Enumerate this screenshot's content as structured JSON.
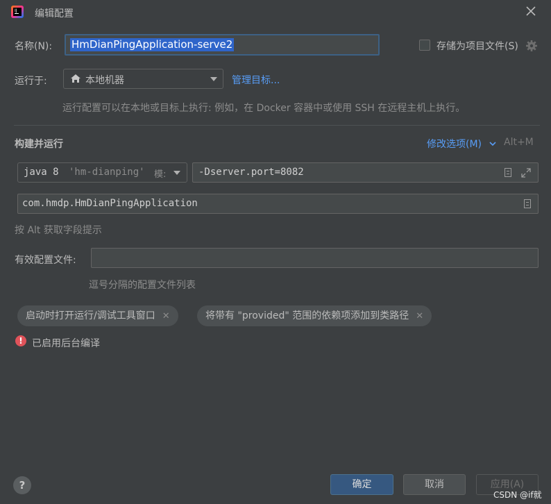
{
  "window": {
    "title": "编辑配置"
  },
  "name_row": {
    "label": "名称(N):",
    "value": "HmDianPingApplication-serve2",
    "store_checkbox_label": "存储为项目文件(S)"
  },
  "run_on": {
    "label": "运行于:",
    "selected": "本地机器",
    "manage_link": "管理目标...",
    "hint": "运行配置可以在本地或目标上执行: 例如，在 Docker 容器中或使用 SSH 在远程主机上执行。"
  },
  "build_run": {
    "section_title": "构建并运行",
    "modify_options": "修改选项(M)",
    "modify_shortcut": "Alt+M",
    "jdk_java": "java 8",
    "jdk_module": "'hm-dianping'",
    "jdk_suffix": "模:",
    "vm_options": "-Dserver.port=8082",
    "main_class": "com.hmdp.HmDianPingApplication",
    "alt_hint": "按 Alt 获取字段提示"
  },
  "profiles": {
    "label": "有效配置文件:",
    "value": "",
    "hint": "逗号分隔的配置文件列表"
  },
  "chips": [
    {
      "label": "启动时打开运行/调试工具窗口"
    },
    {
      "label": "将带有 \"provided\" 范围的依赖项添加到类路径"
    }
  ],
  "warning": {
    "text": "已启用后台编译"
  },
  "buttons": {
    "ok": "确定",
    "cancel": "取消",
    "apply": "应用(A)"
  },
  "watermark": "CSDN @if就",
  "colors": {
    "accent": "#4a88c7",
    "link": "#589df6",
    "error": "#e0535a"
  }
}
